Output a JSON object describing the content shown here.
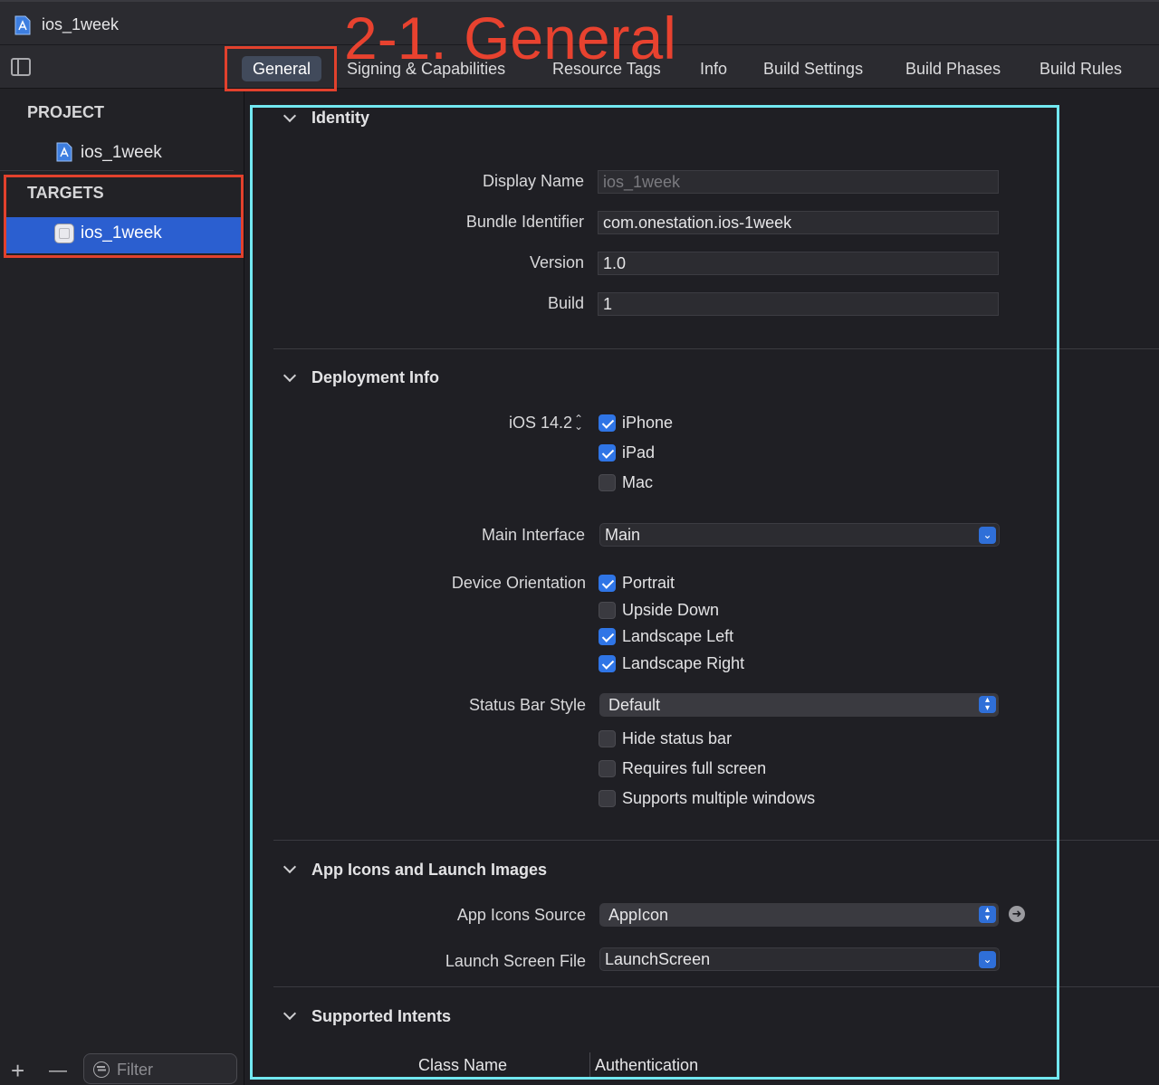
{
  "window": {
    "title": "ios_1week"
  },
  "tabs": [
    {
      "label": "General",
      "selected": true
    },
    {
      "label": "Signing & Capabilities"
    },
    {
      "label": "Resource Tags"
    },
    {
      "label": "Info"
    },
    {
      "label": "Build Settings"
    },
    {
      "label": "Build Phases"
    },
    {
      "label": "Build Rules"
    }
  ],
  "annotation": {
    "label": "2-1. General",
    "color": "#e8422f",
    "highlight_color": "#72e8f1"
  },
  "sidebar": {
    "project_header": "PROJECT",
    "project_item": "ios_1week",
    "targets_header": "TARGETS",
    "target_item": "ios_1week",
    "filter_placeholder": "Filter",
    "add_label": "+",
    "remove_label": "—",
    "selection_color": "#2b5fd0"
  },
  "identity": {
    "title": "Identity",
    "display_name_label": "Display Name",
    "display_name_value": "ios_1week",
    "bundle_id_label": "Bundle Identifier",
    "bundle_id_value": "com.onestation.ios-1week",
    "version_label": "Version",
    "version_value": "1.0",
    "build_label": "Build",
    "build_value": "1"
  },
  "deployment": {
    "title": "Deployment Info",
    "ios_version": "iOS 14.2",
    "devices": [
      {
        "label": "iPhone",
        "checked": true
      },
      {
        "label": "iPad",
        "checked": true
      },
      {
        "label": "Mac",
        "checked": false
      }
    ],
    "main_interface_label": "Main Interface",
    "main_interface_value": "Main",
    "orientation_label": "Device Orientation",
    "orientations": [
      {
        "label": "Portrait",
        "checked": true
      },
      {
        "label": "Upside Down",
        "checked": false
      },
      {
        "label": "Landscape Left",
        "checked": true
      },
      {
        "label": "Landscape Right",
        "checked": true
      }
    ],
    "status_bar_label": "Status Bar Style",
    "status_bar_value": "Default",
    "status_options": [
      {
        "label": "Hide status bar",
        "checked": false
      },
      {
        "label": "Requires full screen",
        "checked": false
      },
      {
        "label": "Supports multiple windows",
        "checked": false
      }
    ]
  },
  "app_icons": {
    "title": "App Icons and Launch Images",
    "source_label": "App Icons Source",
    "source_value": "AppIcon",
    "launch_label": "Launch Screen File",
    "launch_value": "LaunchScreen"
  },
  "intents": {
    "title": "Supported Intents",
    "col_class": "Class Name",
    "col_auth": "Authentication"
  }
}
